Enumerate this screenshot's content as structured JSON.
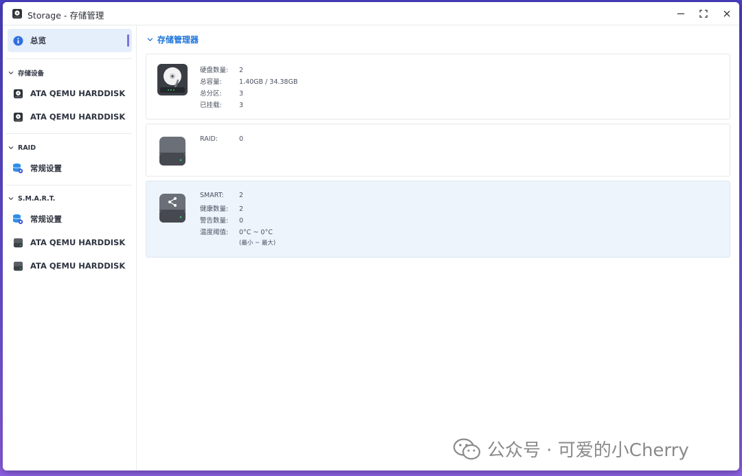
{
  "window": {
    "title": "Storage - 存储管理"
  },
  "sidebar": {
    "overview_label": "总览",
    "sections": [
      {
        "label": "存储设备",
        "items": [
          "ATA QEMU HARDDISK",
          "ATA QEMU HARDDISK"
        ]
      },
      {
        "label": "RAID",
        "items": [
          "常规设置"
        ]
      },
      {
        "label": "S.M.A.R.T.",
        "items": [
          "常规设置",
          "ATA QEMU HARDDISK",
          "ATA QEMU HARDDISK"
        ]
      }
    ]
  },
  "main": {
    "header": "存储管理器",
    "cards": [
      {
        "icon": "hdd-icon",
        "rows": [
          {
            "key": "硬盘数量:",
            "value": "2"
          },
          {
            "key": "总容量:",
            "value": "1.40GB / 34.38GB"
          },
          {
            "key": "总分区:",
            "value": "3"
          },
          {
            "key": "已挂载:",
            "value": "3"
          }
        ]
      },
      {
        "icon": "raid-drive-icon",
        "rows": [
          {
            "key": "RAID:",
            "value": "0"
          }
        ]
      },
      {
        "icon": "smart-drive-icon",
        "rows": [
          {
            "key": "SMART:",
            "value": "2"
          },
          {
            "key": "健康数量:",
            "value": "2"
          },
          {
            "key": "警告数量:",
            "value": "0"
          },
          {
            "key": "温度阈值:",
            "value": "0°C ~ 0°C"
          }
        ],
        "note": "(最小 ~ 最大)"
      }
    ]
  },
  "watermark": {
    "text": "公众号 · 可爱的小Cherry"
  },
  "colors": {
    "accent": "#1a73d9",
    "active_item_bg": "#e5eefb",
    "highlight_card_bg": "#edf4fc",
    "active_indicator": "#7b74d8"
  }
}
